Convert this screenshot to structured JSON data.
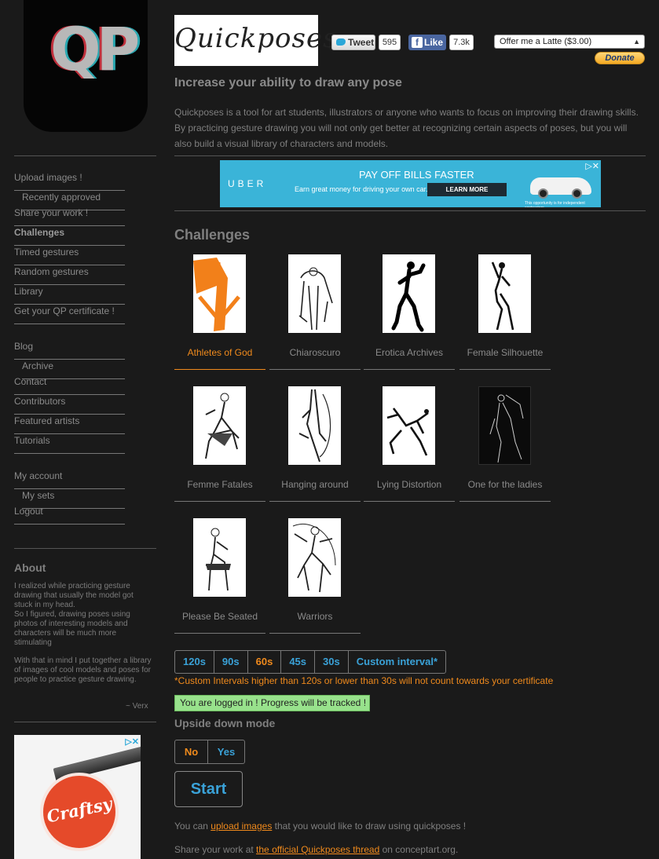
{
  "logo": {
    "text": "QP"
  },
  "nav": [
    {
      "label": "Upload images !",
      "sub": false,
      "bold": false
    },
    {
      "label": "Recently approved",
      "sub": true,
      "bold": false
    },
    {
      "label": "Share your work !",
      "sub": false,
      "bold": false
    },
    {
      "label": "Challenges",
      "sub": false,
      "bold": true
    },
    {
      "label": "Timed gestures",
      "sub": false,
      "bold": false
    },
    {
      "label": "Random gestures",
      "sub": false,
      "bold": false
    },
    {
      "label": "Library",
      "sub": false,
      "bold": false
    },
    {
      "label": "Get your QP certificate !",
      "sub": false,
      "bold": false
    },
    {
      "label": "Blog",
      "sub": false,
      "bold": false
    },
    {
      "label": "Archive",
      "sub": true,
      "bold": false
    },
    {
      "label": "Contact",
      "sub": false,
      "bold": false
    },
    {
      "label": "Contributors",
      "sub": false,
      "bold": false
    },
    {
      "label": "Featured artists",
      "sub": false,
      "bold": false
    },
    {
      "label": "Tutorials",
      "sub": false,
      "bold": false
    },
    {
      "label": "My account",
      "sub": false,
      "bold": false
    },
    {
      "label": "My sets",
      "sub": true,
      "bold": false
    },
    {
      "label": "Logout",
      "sub": false,
      "bold": false
    }
  ],
  "about": {
    "title": "About",
    "p1": "I realized while practicing gesture drawing that usually the model got stuck in my head.",
    "p2": "So I figured, drawing poses using photos of interesting models and characters will be much more stimulating",
    "p3": "With that in mind I put together a library of images of cool models and poses for people to practice gesture drawing.",
    "sign": "~ Verx"
  },
  "side_ad": {
    "brand": "Craftsy",
    "choice": "▷✕"
  },
  "header": {
    "brand": "Quickposes",
    "tweet_label": "Tweet",
    "tweet_count": "595",
    "like_label": "Like",
    "like_count": "7.3k",
    "latte_option": "Offer me a Latte ($3.00)",
    "donate_label": "Donate",
    "tagline": "Increase your ability to draw any pose",
    "intro": "Quickposes is a tool for art students, illustrators or anyone who wants to focus on improving their drawing skills. By practicing gesture drawing you will not only get better at recognizing certain aspects of poses, but you will also build a visual library of characters and models."
  },
  "uber_ad": {
    "logo": "UBER",
    "headline": "PAY OFF BILLS FASTER",
    "sub": "Earn great money for driving your own car.",
    "cta": "LEARN MORE",
    "fine": "This opportunity is for independent contractors",
    "close": "▷✕"
  },
  "challenges": {
    "title": "Challenges",
    "items": [
      {
        "label": "Athletes of God",
        "active": true,
        "dark": false
      },
      {
        "label": "Chiaroscuro",
        "active": false,
        "dark": false
      },
      {
        "label": "Erotica Archives",
        "active": false,
        "dark": false
      },
      {
        "label": "Female Silhouette",
        "active": false,
        "dark": false
      },
      {
        "label": "Femme Fatales",
        "active": false,
        "dark": false
      },
      {
        "label": "Hanging around",
        "active": false,
        "dark": false
      },
      {
        "label": "Lying Distortion",
        "active": false,
        "dark": false
      },
      {
        "label": "One for the ladies",
        "active": false,
        "dark": true
      },
      {
        "label": "Please Be Seated",
        "active": false,
        "dark": false
      },
      {
        "label": "Warriors",
        "active": false,
        "dark": false
      }
    ]
  },
  "intervals": {
    "options": [
      "120s",
      "90s",
      "60s",
      "45s",
      "30s",
      "Custom interval*"
    ],
    "selected": "60s",
    "warning": "*Custom Intervals higher than 120s or lower than 30s will not count towards your certificate"
  },
  "status": {
    "logged_in": "You are logged in ! Progress will be tracked !"
  },
  "upside_down": {
    "title": "Upside down mode",
    "no": "No",
    "yes": "Yes",
    "selected": "No"
  },
  "start_label": "Start",
  "footer": {
    "upload_pre": "You can ",
    "upload_link": "upload images",
    "upload_post": " that you would like to draw using quickposes !",
    "share_pre": "Share your work at ",
    "share_link": "the official Quickposes thread",
    "share_post": " on conceptart.org."
  },
  "colors": {
    "accent": "#f08a1c",
    "link_blue": "#3aa2d8",
    "background": "#1a1a1a",
    "success": "#98e28c"
  }
}
